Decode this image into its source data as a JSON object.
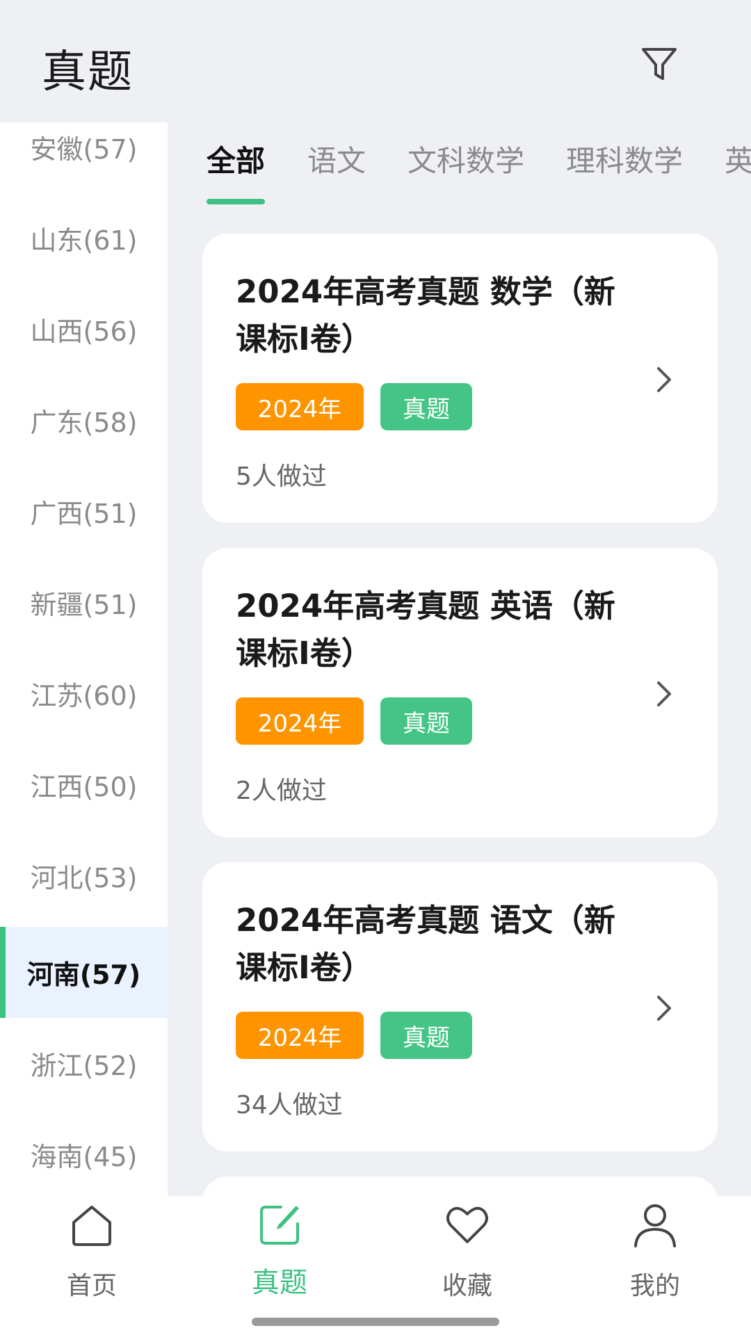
{
  "header": {
    "title": "真题"
  },
  "sidebar": {
    "items": [
      {
        "label": "安徽(57)"
      },
      {
        "label": "山东(61)"
      },
      {
        "label": "山西(56)"
      },
      {
        "label": "广东(58)"
      },
      {
        "label": "广西(51)"
      },
      {
        "label": "新疆(51)"
      },
      {
        "label": "江苏(60)"
      },
      {
        "label": "江西(50)"
      },
      {
        "label": "河北(53)"
      },
      {
        "label": "河南(57)",
        "selected": true
      },
      {
        "label": "浙江(52)"
      },
      {
        "label": "海南(45)"
      }
    ]
  },
  "tabs": {
    "items": [
      {
        "label": "全部",
        "selected": true
      },
      {
        "label": "语文"
      },
      {
        "label": "文科数学"
      },
      {
        "label": "理科数学"
      },
      {
        "label": "英"
      }
    ]
  },
  "cards": [
    {
      "title": "2024年高考真题 数学（新课标I卷）",
      "year_tag": "2024年",
      "type_tag": "真题",
      "meta": "5人做过"
    },
    {
      "title": "2024年高考真题 英语（新课标I卷）",
      "year_tag": "2024年",
      "type_tag": "真题",
      "meta": "2人做过"
    },
    {
      "title": "2024年高考真题 语文（新课标I卷）",
      "year_tag": "2024年",
      "type_tag": "真题",
      "meta": "34人做过"
    }
  ],
  "bottom_nav": {
    "items": [
      {
        "label": "首页",
        "icon": "home-icon"
      },
      {
        "label": "真题",
        "icon": "edit-icon",
        "selected": true
      },
      {
        "label": "收藏",
        "icon": "heart-icon"
      },
      {
        "label": "我的",
        "icon": "user-icon"
      }
    ]
  },
  "colors": {
    "accent_green": "#3fc183",
    "tag_orange": "#fe9400",
    "tag_green": "#44c586",
    "selected_bg": "#eaf2ff"
  }
}
